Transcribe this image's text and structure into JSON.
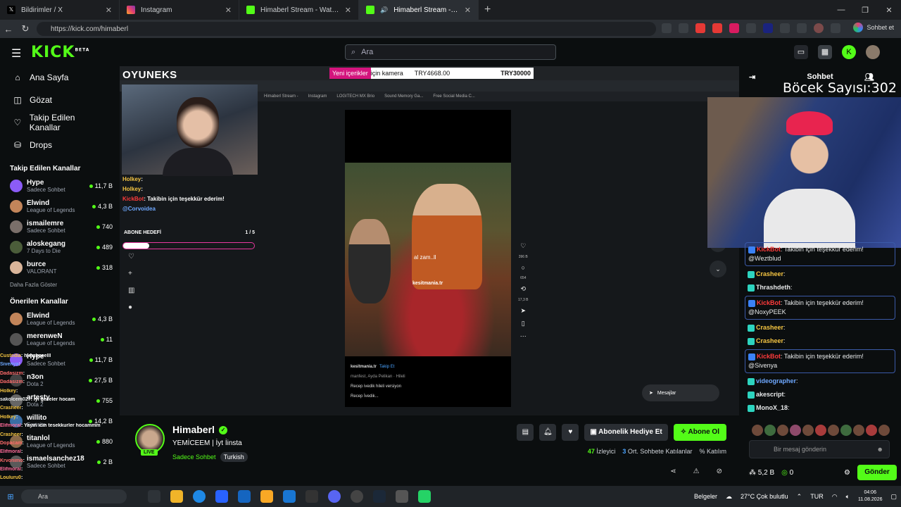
{
  "browser": {
    "tabs": [
      {
        "label": "Bildirimler / X",
        "icon": "x-icon",
        "color": "#000000"
      },
      {
        "label": "Instagram",
        "icon": "instagram-icon",
        "color": "#e4406f"
      },
      {
        "label": "Himaberl Stream - Watch Live on Kick",
        "icon": "kick-icon",
        "color": "#53fc18"
      },
      {
        "label": "Himaberl Stream - Watch Live on Kick",
        "icon": "kick-icon",
        "color": "#53fc18"
      }
    ],
    "url": "https://kick.com/himaberl",
    "profile_label": "Sohbet et"
  },
  "kick": {
    "brand": "KICK",
    "beta": "BETA",
    "search_placeholder": "Ara",
    "accent": "#53fc18"
  },
  "sidebar": {
    "nav": [
      {
        "label": "Ana Sayfa",
        "icon": "home-icon"
      },
      {
        "label": "Gözat",
        "icon": "compass-icon"
      },
      {
        "label": "Takip Edilen Kanallar",
        "icon": "heart-icon"
      },
      {
        "label": "Drops",
        "icon": "drops-icon"
      }
    ],
    "followed_title": "Takip Edilen Kanallar",
    "followed": [
      {
        "name": "Hype",
        "game": "Sadece Sohbet",
        "viewers": "11,7 B",
        "color": "#8b5cf6"
      },
      {
        "name": "Elwind",
        "game": "League of Legends",
        "viewers": "4,3 B",
        "color": "#c2855a"
      },
      {
        "name": "ismailemre",
        "game": "Sadece Sohbet",
        "viewers": "740",
        "color": "#7a6f6a"
      },
      {
        "name": "aloskegang",
        "game": "7 Days to Die",
        "viewers": "489",
        "color": "#4b5d3a"
      },
      {
        "name": "burce",
        "game": "VALORANT",
        "viewers": "318",
        "color": "#d9b59a"
      }
    ],
    "show_more": "Daha Fazla Göster",
    "recommended_title": "Önerilen Kanallar",
    "recommended": [
      {
        "name": "Elwind",
        "game": "League of Legends",
        "viewers": "4,3 B",
        "color": "#c2855a"
      },
      {
        "name": "merenweN",
        "game": "League of Legends",
        "viewers": "11",
        "color": "#555555"
      },
      {
        "name": "Hype",
        "game": "Sadece Sohbet",
        "viewers": "11,7 B",
        "color": "#8b5cf6"
      },
      {
        "name": "n3on",
        "game": "Dota 2",
        "viewers": "27,5 B",
        "color": "#444444"
      },
      {
        "name": "artesty",
        "game": "Dota 2",
        "viewers": "755",
        "color": "#666666"
      },
      {
        "name": "willito",
        "game": "Fortnite",
        "viewers": "14,2 B",
        "color": "#3a6ea5"
      },
      {
        "name": "titanlol",
        "game": "League of Legends",
        "viewers": "880",
        "color": "#8a6a4a"
      },
      {
        "name": "ismaelsanchez18",
        "game": "Sadece Sohbet",
        "viewers": "2 B",
        "color": "#5a5a5a"
      }
    ]
  },
  "stream_overlay": {
    "brand": "OYUNEKS",
    "alert_highlight": "Yeni içerikler",
    "alert_rest": " için kamera",
    "alert_amount": "TRY4668.00",
    "alert_goal": "TRY30000",
    "inner_tabs": [
      "Himaberl Stream -",
      "Instagram",
      "LOGITECH MX Brio",
      "Sound Memory Ga...",
      "Free Social Media C..."
    ],
    "chat": [
      {
        "user": "Holkey",
        "text": ":",
        "color": "#f5c542"
      },
      {
        "user": "Holkey",
        "text": ":",
        "color": "#f5c542"
      },
      {
        "user": "KickBot",
        "text": ": Takibin için teşekkür ederim!",
        "color": "#ff3b3b"
      },
      {
        "user": "@Corvoidea",
        "text": "",
        "color": "#6ea8ff"
      }
    ],
    "sub_goal_label": "ABONE HEDEFİ",
    "sub_goal_count": "1 / 5",
    "sub_goal_progress": 0.2,
    "video_subtitle": "al zam..ll",
    "video_watermark": "kesitmania.tr",
    "video_author": "kesitmania.tr",
    "video_follow": "Takip Et",
    "video_author_sub": "manfest, Ayda Pelikan · Hileli",
    "video_caption": "Recep ivedik hileli versiyon",
    "video_audio": "Recep İvedik...",
    "video_stats": [
      "396 B",
      "654",
      "17,3 B"
    ],
    "messages_label": "Mesajlar"
  },
  "left_overlay_chat": [
    {
      "user": "Custodia",
      "text": ": himabeeelll",
      "color": "#f5c542"
    },
    {
      "user": "Sivenya",
      "text": ":",
      "color": "#6ea8ff"
    },
    {
      "user": "Dadasizm",
      "text": ":",
      "color": "#ff6b6b"
    },
    {
      "user": "Dadasizm",
      "text": ":",
      "color": "#ff6b6b"
    },
    {
      "user": "Holkey",
      "text": ":",
      "color": "#f5c542"
    },
    {
      "user": "sakolcem027",
      "text": ": iyi geceler hocam",
      "color": "#e7e9ea"
    },
    {
      "user": "Crasheer",
      "text": ":",
      "color": "#f5c542"
    },
    {
      "user": "Holkey",
      "text": ":",
      "color": "#f5c542"
    },
    {
      "user": "Elifmoral",
      "text": ": Yayin icin tesekkurler hocammm",
      "color": "#ff6b9a"
    },
    {
      "user": "Crasheer",
      "text": ":",
      "color": "#f5c542"
    },
    {
      "user": "Dopacam",
      "text": ":",
      "color": "#ff6b6b"
    },
    {
      "user": "Elifmoral",
      "text": ":",
      "color": "#ff6b9a"
    },
    {
      "user": "Krvonimo",
      "text": ":",
      "color": "#ff6b6b"
    },
    {
      "user": "Elifmoral",
      "text": ":",
      "color": "#ff6b9a"
    },
    {
      "user": "Louluru0",
      "text": ":",
      "color": "#f5c542"
    }
  ],
  "channel": {
    "name": "Himaberl",
    "live": "LIVE",
    "title": "YEMİCEEM | İyt İinsta",
    "category": "Sadece Sohbet",
    "language": "Turkish",
    "gift_label": "Abonelik Hediye Et",
    "subscribe_label": "Abone Ol",
    "viewers": "47",
    "viewers_label": "İzleyici",
    "avg": "3",
    "avg_label": "Ort. Sohbete Katılanlar",
    "participation_label": "% Katılım"
  },
  "chat": {
    "title": "Sohbet",
    "bug_counter": "Böcek Sayısı:302",
    "messages": [
      {
        "user": "KickBot",
        "text": ": Takibin için teşekkür ederim! @Weztblud",
        "color": "#ff3b3b",
        "bot": true
      },
      {
        "user": "Crasheer",
        "text": ":",
        "color": "#f5c542",
        "bot": false
      },
      {
        "user": "Thrashdeth",
        "text": ":",
        "color": "#e7e9ea",
        "bot": false
      },
      {
        "user": "KickBot",
        "text": ": Takibin için teşekkür ederim! @NoxyPEEK",
        "color": "#ff3b3b",
        "bot": true
      },
      {
        "user": "Crasheer",
        "text": ":",
        "color": "#f5c542",
        "bot": false
      },
      {
        "user": "Crasheer",
        "text": ":",
        "color": "#f5c542",
        "bot": false
      },
      {
        "user": "KickBot",
        "text": ": Takibin için teşekkür ederim! @Sivenya",
        "color": "#ff3b3b",
        "bot": true
      },
      {
        "user": "videographer",
        "text": ":",
        "color": "#6ea8ff",
        "bot": false
      },
      {
        "user": "akescript",
        "text": ":",
        "color": "#e7e9ea",
        "bot": false
      },
      {
        "user": "MonoX_18",
        "text": ":",
        "color": "#e7e9ea",
        "bot": false
      }
    ],
    "input_placeholder": "Bir mesaj gönderin",
    "points": "5,2 B",
    "kick_points": "0",
    "send_label": "Gönder"
  },
  "taskbar": {
    "search": "Ara",
    "documents": "Belgeler",
    "weather": "27°C  Çok bulutlu",
    "lang": "TUR",
    "time": "04:06",
    "date": "11.08.2026"
  }
}
